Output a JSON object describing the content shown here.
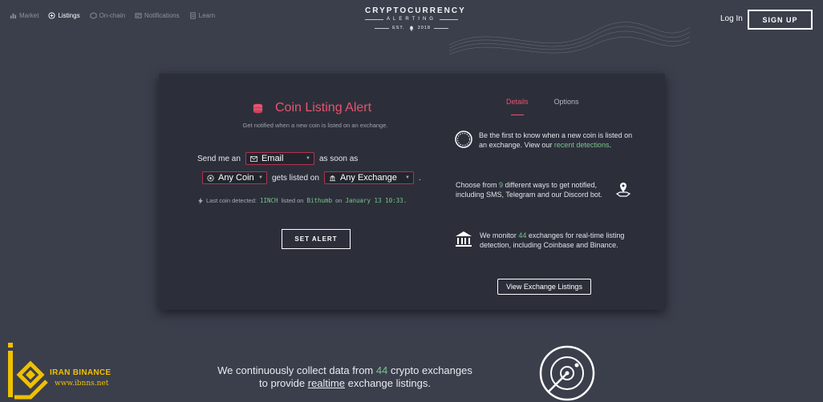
{
  "nav": {
    "items": [
      {
        "label": "Market",
        "icon": "bar-chart-icon"
      },
      {
        "label": "Listings",
        "icon": "plus-circle-icon",
        "active": true
      },
      {
        "label": "On-chain",
        "icon": "cube-icon"
      },
      {
        "label": "Notifications",
        "icon": "message-icon"
      },
      {
        "label": "Learn",
        "icon": "document-icon"
      }
    ],
    "brand_line1": "CRYPTOCURRENCY",
    "brand_line2": "ALERTING",
    "brand_line3": "EST.",
    "brand_year": "2018",
    "login_label": "Log In",
    "signup_label": "SIGN UP"
  },
  "alert_form": {
    "title": "Coin Listing Alert",
    "subtitle": "Get notified when a new coin is listed on an exchange.",
    "send_me_an": "Send me an",
    "method_value": "Email",
    "as_soon_as": "as soon as",
    "coin_value": "Any Coin",
    "gets_listed_on": "gets listed on",
    "exchange_value": "Any Exchange",
    "period": ".",
    "last_prefix": "Last coin detected:",
    "last_coin": "1INCH",
    "listed_on": "listed on",
    "last_exchange": "Bithumb",
    "on": "on",
    "last_time": "January 13 10:33.",
    "set_alert_label": "SET ALERT"
  },
  "details": {
    "tabs": [
      "Details",
      "Options"
    ],
    "f1_text": "Be the first to know when a new coin is listed on an exchange. View our ",
    "f1_link": "recent detections",
    "f1_end": ".",
    "f2_pre": "Choose from ",
    "f2_num": "9",
    "f2_post": " different ways to get notified, including SMS, Telegram and our Discord bot.",
    "f3_pre": "We monitor ",
    "f3_num": "44",
    "f3_post": " exchanges for real-time listing detection, including Coinbase and Binance.",
    "view_btn": "View Exchange Listings"
  },
  "bottom": {
    "line1_pre": "We continuously collect data from ",
    "line1_num": "44",
    "line1_post": " crypto exchanges",
    "line2_pre": "to provide ",
    "line2_link": "realtime",
    "line2_post": " exchange listings."
  },
  "watermark": {
    "name": "IRAN BINANCE",
    "url": "www.ibnns.net"
  },
  "colors": {
    "accent": "#e8546f",
    "green": "#79c58b",
    "background": "#3b3f4c",
    "card": "#2c2f3a"
  }
}
